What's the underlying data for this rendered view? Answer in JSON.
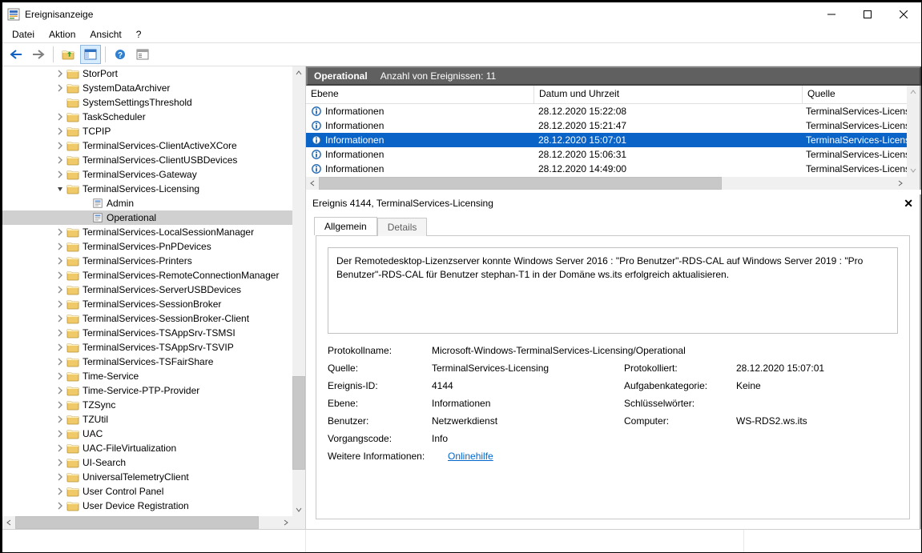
{
  "window": {
    "title": "Ereignisanzeige"
  },
  "menu": {
    "datei": "Datei",
    "aktion": "Aktion",
    "ansicht": "Ansicht",
    "help": "?"
  },
  "tree_rows": [
    {
      "indent": 64,
      "exp": ">",
      "folder": true,
      "label": "StorPort"
    },
    {
      "indent": 64,
      "exp": ">",
      "folder": true,
      "label": "SystemDataArchiver"
    },
    {
      "indent": 64,
      "exp": "",
      "folder": true,
      "label": "SystemSettingsThreshold"
    },
    {
      "indent": 64,
      "exp": ">",
      "folder": true,
      "label": "TaskScheduler"
    },
    {
      "indent": 64,
      "exp": ">",
      "folder": true,
      "label": "TCPIP"
    },
    {
      "indent": 64,
      "exp": ">",
      "folder": true,
      "label": "TerminalServices-ClientActiveXCore"
    },
    {
      "indent": 64,
      "exp": ">",
      "folder": true,
      "label": "TerminalServices-ClientUSBDevices"
    },
    {
      "indent": 64,
      "exp": ">",
      "folder": true,
      "label": "TerminalServices-Gateway"
    },
    {
      "indent": 64,
      "exp": "v",
      "folder": true,
      "label": "TerminalServices-Licensing"
    },
    {
      "indent": 96,
      "exp": "",
      "leaf": true,
      "label": "Admin"
    },
    {
      "indent": 96,
      "exp": "",
      "leaf": true,
      "label": "Operational",
      "sel": true
    },
    {
      "indent": 64,
      "exp": ">",
      "folder": true,
      "label": "TerminalServices-LocalSessionManager"
    },
    {
      "indent": 64,
      "exp": ">",
      "folder": true,
      "label": "TerminalServices-PnPDevices"
    },
    {
      "indent": 64,
      "exp": ">",
      "folder": true,
      "label": "TerminalServices-Printers"
    },
    {
      "indent": 64,
      "exp": ">",
      "folder": true,
      "label": "TerminalServices-RemoteConnectionManager"
    },
    {
      "indent": 64,
      "exp": ">",
      "folder": true,
      "label": "TerminalServices-ServerUSBDevices"
    },
    {
      "indent": 64,
      "exp": ">",
      "folder": true,
      "label": "TerminalServices-SessionBroker"
    },
    {
      "indent": 64,
      "exp": ">",
      "folder": true,
      "label": "TerminalServices-SessionBroker-Client"
    },
    {
      "indent": 64,
      "exp": ">",
      "folder": true,
      "label": "TerminalServices-TSAppSrv-TSMSI"
    },
    {
      "indent": 64,
      "exp": ">",
      "folder": true,
      "label": "TerminalServices-TSAppSrv-TSVIP"
    },
    {
      "indent": 64,
      "exp": ">",
      "folder": true,
      "label": "TerminalServices-TSFairShare"
    },
    {
      "indent": 64,
      "exp": ">",
      "folder": true,
      "label": "Time-Service"
    },
    {
      "indent": 64,
      "exp": ">",
      "folder": true,
      "label": "Time-Service-PTP-Provider"
    },
    {
      "indent": 64,
      "exp": ">",
      "folder": true,
      "label": "TZSync"
    },
    {
      "indent": 64,
      "exp": ">",
      "folder": true,
      "label": "TZUtil"
    },
    {
      "indent": 64,
      "exp": ">",
      "folder": true,
      "label": "UAC"
    },
    {
      "indent": 64,
      "exp": ">",
      "folder": true,
      "label": "UAC-FileVirtualization"
    },
    {
      "indent": 64,
      "exp": ">",
      "folder": true,
      "label": "UI-Search"
    },
    {
      "indent": 64,
      "exp": ">",
      "folder": true,
      "label": "UniversalTelemetryClient"
    },
    {
      "indent": 64,
      "exp": ">",
      "folder": true,
      "label": "User Control Panel"
    },
    {
      "indent": 64,
      "exp": ">",
      "folder": true,
      "label": "User Device Registration"
    }
  ],
  "list_header": {
    "title": "Operational",
    "count_label": "Anzahl von Ereignissen: 11"
  },
  "cols": {
    "ebene": "Ebene",
    "datum": "Datum und Uhrzeit",
    "quelle": "Quelle"
  },
  "events": [
    {
      "level": "Informationen",
      "date": "28.12.2020 15:22:08",
      "source": "TerminalServices-Licensing"
    },
    {
      "level": "Informationen",
      "date": "28.12.2020 15:21:47",
      "source": "TerminalServices-Licensing"
    },
    {
      "level": "Informationen",
      "date": "28.12.2020 15:07:01",
      "source": "TerminalServices-Licensing",
      "sel": true
    },
    {
      "level": "Informationen",
      "date": "28.12.2020 15:06:31",
      "source": "TerminalServices-Licensing"
    },
    {
      "level": "Informationen",
      "date": "28.12.2020 14:49:00",
      "source": "TerminalServices-Licensing"
    }
  ],
  "detail": {
    "title": "Ereignis 4144, TerminalServices-Licensing",
    "tab_general": "Allgemein",
    "tab_details": "Details",
    "message": "Der Remotedesktop-Lizenzserver konnte Windows Server 2016 : \"Pro Benutzer\"-RDS-CAL auf Windows Server 2019 : \"Pro Benutzer\"-RDS-CAL für Benutzer stephan-T1 in der Domäne ws.its erfolgreich aktualisieren.",
    "labels": {
      "logname": "Protokollname:",
      "source": "Quelle:",
      "logged": "Protokolliert:",
      "eventid": "Ereignis-ID:",
      "taskcat": "Aufgabenkategorie:",
      "level": "Ebene:",
      "keywords": "Schlüsselwörter:",
      "user": "Benutzer:",
      "computer": "Computer:",
      "opcode": "Vorgangscode:",
      "moreinfo": "Weitere Informationen:"
    },
    "values": {
      "logname": "Microsoft-Windows-TerminalServices-Licensing/Operational",
      "source": "TerminalServices-Licensing",
      "logged": "28.12.2020 15:07:01",
      "eventid": "4144",
      "taskcat": "Keine",
      "level": "Informationen",
      "keywords": "",
      "user": "Netzwerkdienst",
      "computer": "WS-RDS2.ws.its",
      "opcode": "Info",
      "helplink": "Onlinehilfe"
    }
  }
}
